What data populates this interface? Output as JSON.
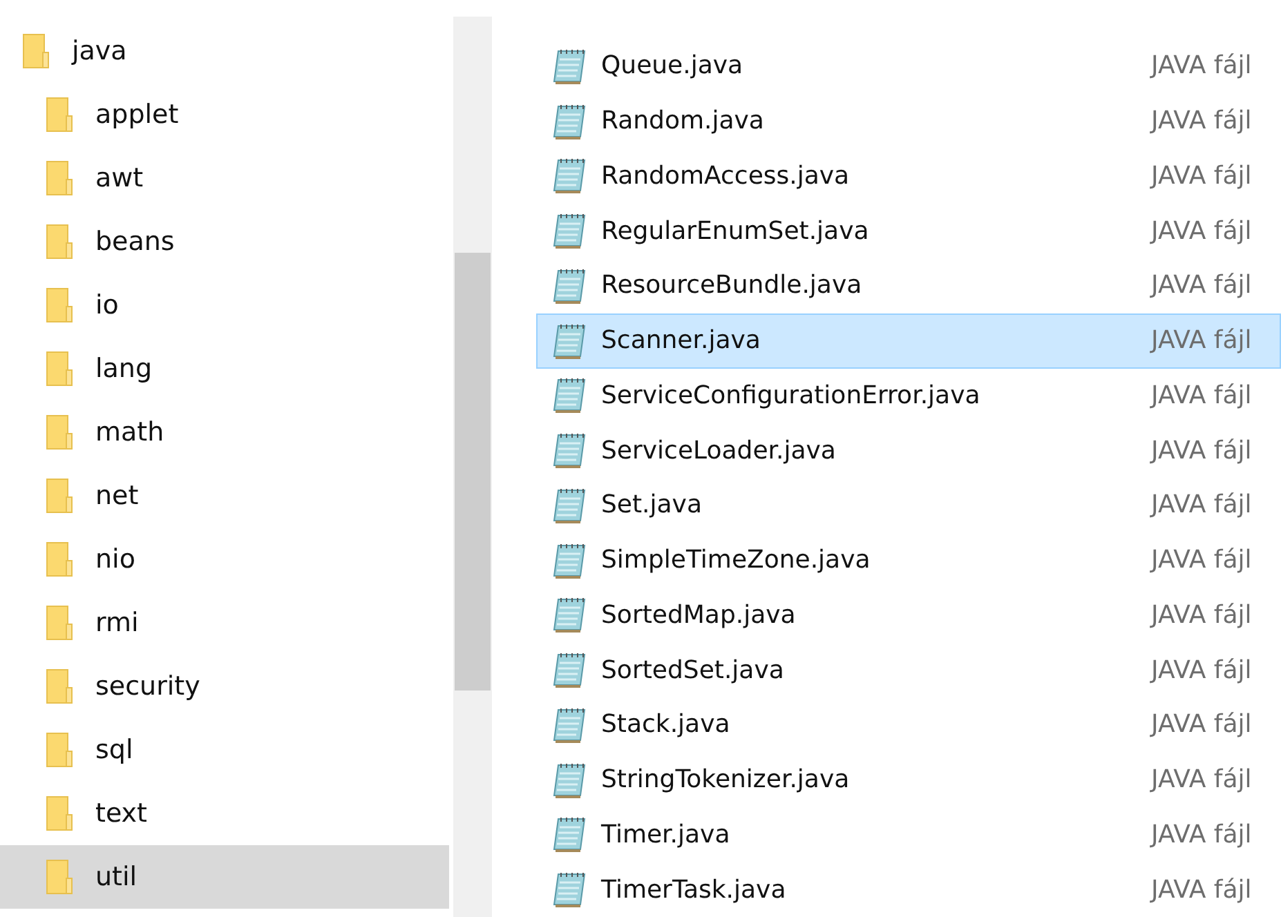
{
  "tree": {
    "label": "java",
    "selected": false,
    "children": [
      {
        "label": "applet",
        "selected": false
      },
      {
        "label": "awt",
        "selected": false
      },
      {
        "label": "beans",
        "selected": false
      },
      {
        "label": "io",
        "selected": false
      },
      {
        "label": "lang",
        "selected": false
      },
      {
        "label": "math",
        "selected": false
      },
      {
        "label": "net",
        "selected": false
      },
      {
        "label": "nio",
        "selected": false
      },
      {
        "label": "rmi",
        "selected": false
      },
      {
        "label": "security",
        "selected": false
      },
      {
        "label": "sql",
        "selected": false
      },
      {
        "label": "text",
        "selected": false
      },
      {
        "label": "util",
        "selected": true
      }
    ]
  },
  "files": [
    {
      "name": "Queue.java",
      "type": "JAVA fájl",
      "selected": false
    },
    {
      "name": "Random.java",
      "type": "JAVA fájl",
      "selected": false
    },
    {
      "name": "RandomAccess.java",
      "type": "JAVA fájl",
      "selected": false
    },
    {
      "name": "RegularEnumSet.java",
      "type": "JAVA fájl",
      "selected": false
    },
    {
      "name": "ResourceBundle.java",
      "type": "JAVA fájl",
      "selected": false
    },
    {
      "name": "Scanner.java",
      "type": "JAVA fájl",
      "selected": true
    },
    {
      "name": "ServiceConfigurationError.java",
      "type": "JAVA fájl",
      "selected": false
    },
    {
      "name": "ServiceLoader.java",
      "type": "JAVA fájl",
      "selected": false
    },
    {
      "name": "Set.java",
      "type": "JAVA fájl",
      "selected": false
    },
    {
      "name": "SimpleTimeZone.java",
      "type": "JAVA fájl",
      "selected": false
    },
    {
      "name": "SortedMap.java",
      "type": "JAVA fájl",
      "selected": false
    },
    {
      "name": "SortedSet.java",
      "type": "JAVA fájl",
      "selected": false
    },
    {
      "name": "Stack.java",
      "type": "JAVA fájl",
      "selected": false
    },
    {
      "name": "StringTokenizer.java",
      "type": "JAVA fájl",
      "selected": false
    },
    {
      "name": "Timer.java",
      "type": "JAVA fájl",
      "selected": false
    },
    {
      "name": "TimerTask.java",
      "type": "JAVA fájl",
      "selected": false
    }
  ]
}
